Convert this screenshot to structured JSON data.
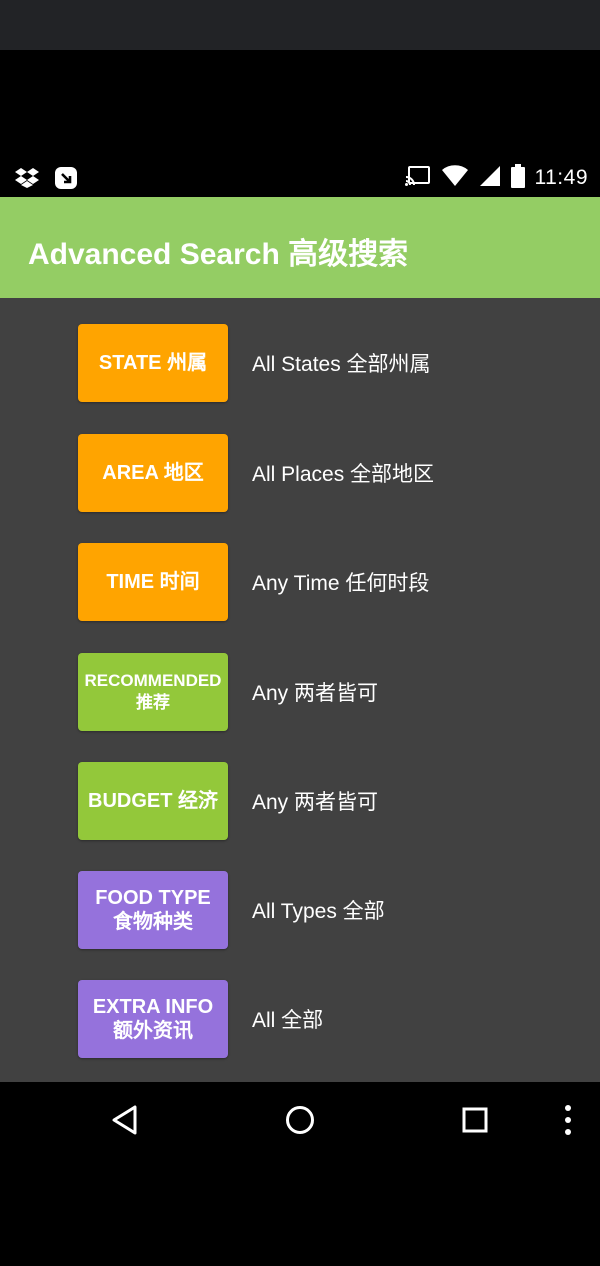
{
  "status_bar": {
    "time": "11:49",
    "left_icons": [
      "dropbox-icon",
      "download-icon"
    ],
    "right_icons": [
      "cast-icon",
      "wifi-icon",
      "signal-icon",
      "battery-icon"
    ]
  },
  "header": {
    "title": "Advanced Search 高级搜索",
    "bg_color": "#94cd64"
  },
  "filters": [
    {
      "label": "STATE 州属",
      "value": "All States 全部州属",
      "color": "#ffa400"
    },
    {
      "label": "AREA 地区",
      "value": "All Places 全部地区",
      "color": "#ffa400"
    },
    {
      "label": "TIME 时间",
      "value": "Any Time 任何时段",
      "color": "#ffa400"
    },
    {
      "label_line1": "RECOMMENDED",
      "label_line2": "推荐",
      "value": "Any 两者皆可",
      "color": "#93c83a"
    },
    {
      "label": "BUDGET 经济",
      "value": "Any 两者皆可",
      "color": "#93c83a"
    },
    {
      "label_line1": "FOOD TYPE",
      "label_line2": "食物种类",
      "value": "All Types 全部",
      "color": "#9572dc"
    },
    {
      "label_line1": "EXTRA INFO",
      "label_line2": "额外资讯",
      "value": "All 全部",
      "color": "#9572dc"
    }
  ],
  "nav_bar": {
    "icons": [
      "back-icon",
      "home-icon",
      "recents-icon",
      "more-icon"
    ]
  }
}
